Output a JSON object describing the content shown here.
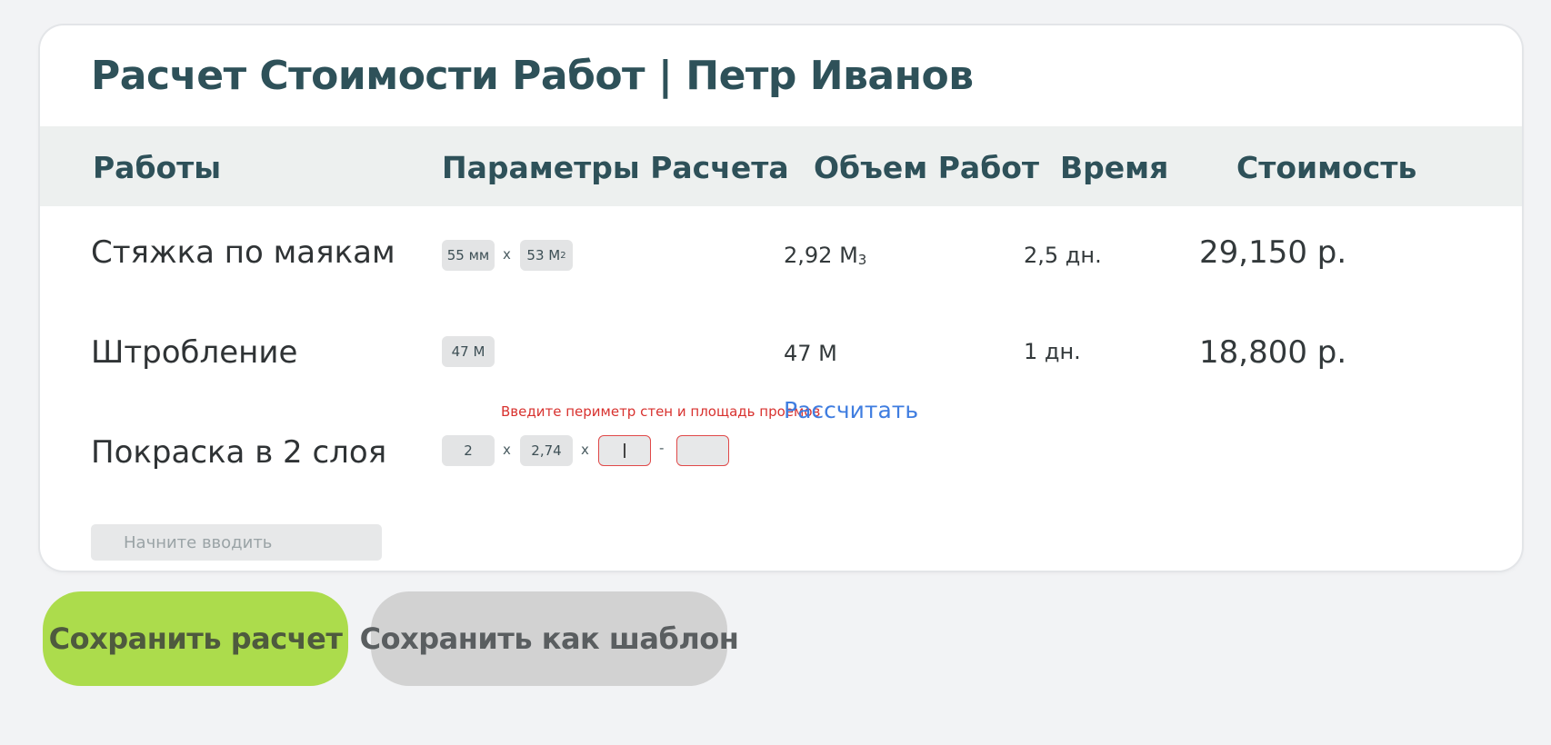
{
  "header": {
    "title": "Расчет Стоимости Работ | Петр Иванов"
  },
  "table": {
    "columns": [
      "Работы",
      "Параметры Расчета",
      "Объем Работ",
      "Время",
      "Стоимость"
    ],
    "rows": [
      {
        "name": "Стяжка по маякам",
        "params": [
          "55 мм",
          "53 М"
        ],
        "param_sub": "2",
        "operators": [
          "x"
        ],
        "volume": "2,92 М",
        "volume_sub": "3",
        "time": "2,5 дн.",
        "price": "29,150 р."
      },
      {
        "name": "Штробление",
        "params": [
          "47 М"
        ],
        "volume": "47 М",
        "time": "1 дн.",
        "price": "18,800 р."
      },
      {
        "name": "Покраска в 2 слоя",
        "params": [
          "2",
          "2,74",
          "",
          ""
        ],
        "operators": [
          "x",
          "x",
          "-"
        ],
        "hint": "Введите периметр стен и площадь проемов",
        "action": "Рассчитать"
      }
    ]
  },
  "search": {
    "placeholder": "Начните вводить"
  },
  "buttons": {
    "save": "Сохранить расчет",
    "template": "Сохранить как шаблон"
  },
  "colors": {
    "title": "#2e5159",
    "save_button": "#acdc4c",
    "template_button": "#d2d2d2",
    "hint": "#d8322f",
    "link": "#3f7de0"
  }
}
